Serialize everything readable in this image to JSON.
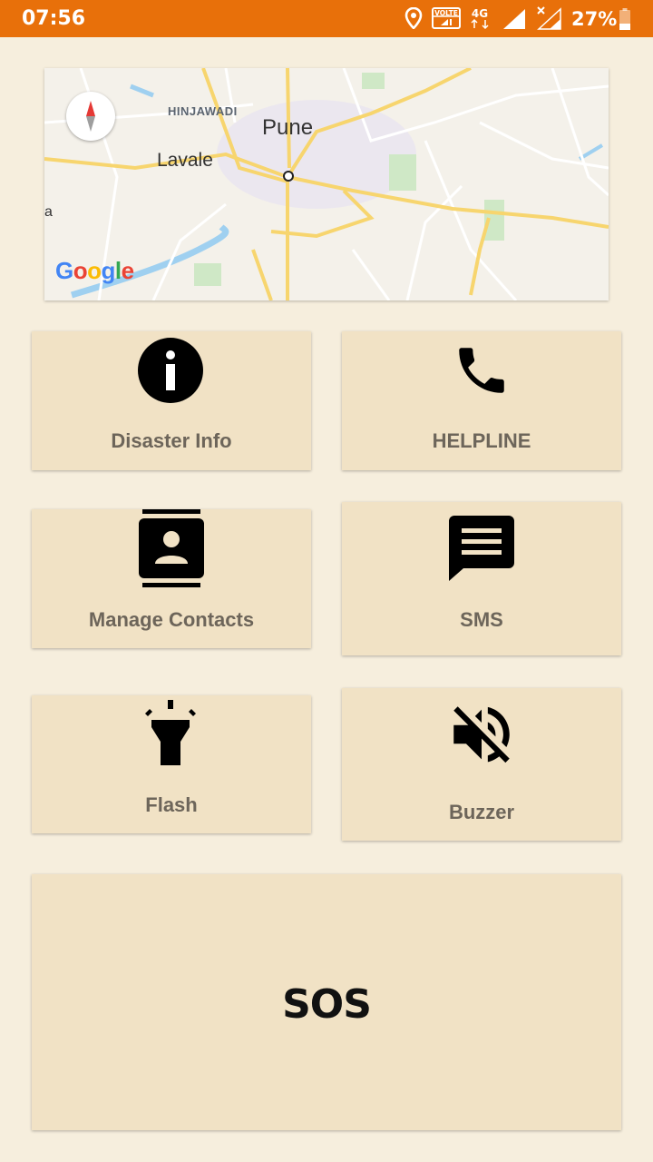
{
  "status_bar": {
    "time": "07:56",
    "battery_percent": "27%",
    "volte_label": "VOLTE",
    "network_label": "4G"
  },
  "map": {
    "labels": {
      "pune": "Pune",
      "lavale": "Lavale",
      "hinjawadi": "HINJAWADI",
      "partial": "a"
    },
    "logo_text": "Google"
  },
  "actions": {
    "disaster_info": {
      "label": "Disaster Info",
      "icon": "info-icon"
    },
    "helpline": {
      "label": "HELPLINE",
      "icon": "phone-icon"
    },
    "manage_contacts": {
      "label": "Manage Contacts",
      "icon": "contacts-icon"
    },
    "sms": {
      "label": "SMS",
      "icon": "message-icon"
    },
    "flash": {
      "label": "Flash",
      "icon": "flashlight-icon"
    },
    "buzzer": {
      "label": "Buzzer",
      "icon": "volume-off-icon"
    },
    "sos": {
      "label": "SOS"
    }
  },
  "colors": {
    "status_bar": "#e8700a",
    "background": "#f6eedd",
    "card": "#f1e2c5",
    "label_text": "#6d655a"
  }
}
